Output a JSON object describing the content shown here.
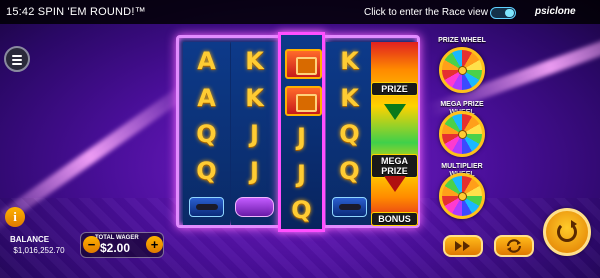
{
  "status_bar": {
    "time": "15:42",
    "game_title": "SPIN 'EM ROUND!™",
    "race_prompt": "Click to enter the Race view",
    "brand": "psiclone"
  },
  "reels": [
    [
      "A",
      "A",
      "Q",
      "Q",
      "jetski"
    ],
    [
      "K",
      "K",
      "J",
      "J",
      "car"
    ],
    [
      "prize-tile",
      "prize-tile",
      "J",
      "J",
      "Q"
    ],
    [
      "K",
      "K",
      "Q",
      "Q",
      "jetski"
    ]
  ],
  "bonus_reel": {
    "labels": [
      "PRIZE",
      "MEGA PRIZE",
      "BONUS"
    ]
  },
  "wheels": [
    {
      "title": "PRIZE WHEEL"
    },
    {
      "title": "MEGA PRIZE WHEEL"
    },
    {
      "title": "MULTIPLIER WHEEL"
    }
  ],
  "balance": {
    "label": "BALANCE",
    "value": "$1,016,252.70"
  },
  "wager": {
    "label": "TOTAL WAGER",
    "value": "$2.00",
    "minus": "−",
    "plus": "+"
  },
  "info_glyph": "i",
  "colors": {
    "accent_gold": "#ffc21a",
    "frame_pink": "#e28cff",
    "bg_purple": "#4a0f9a"
  }
}
